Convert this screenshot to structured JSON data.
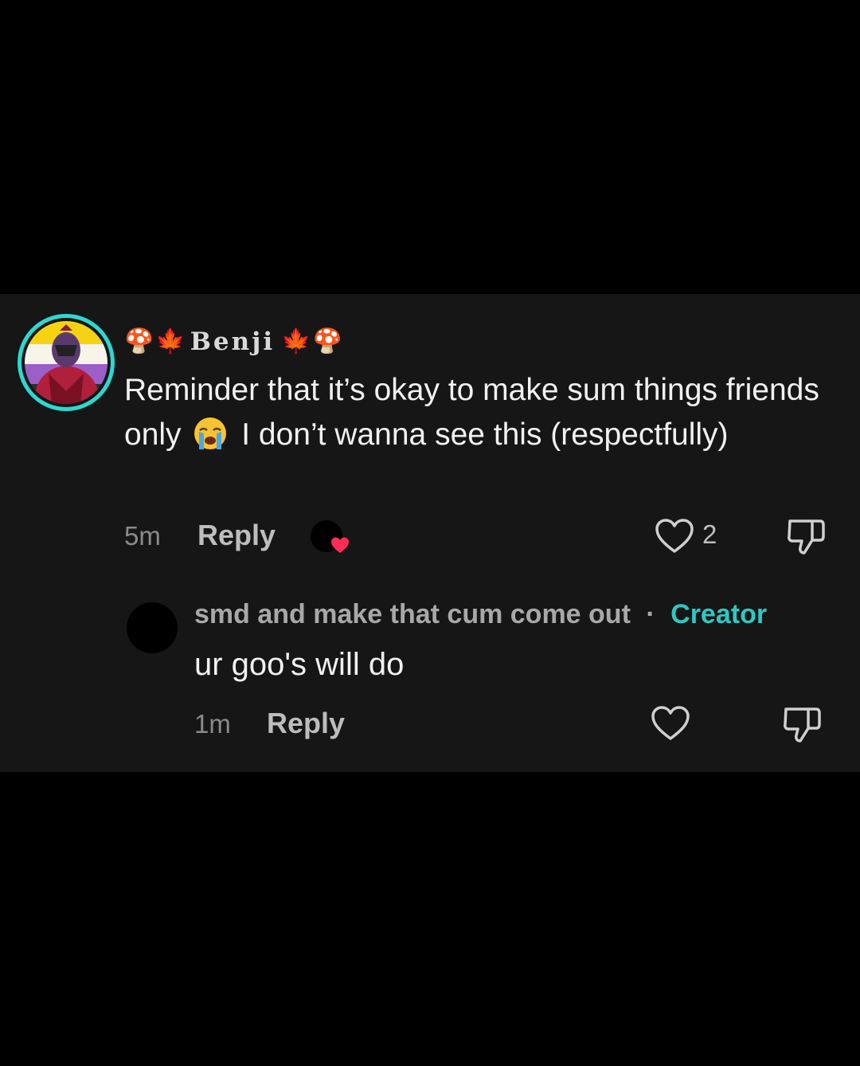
{
  "comment": {
    "username": "Benji",
    "username_emoji_left": [
      "🍄",
      "🍁"
    ],
    "username_emoji_right": [
      "🍁",
      "🍄"
    ],
    "text_part1": "Reminder that it’s okay to make sum things friends only",
    "text_emoji": "😭",
    "text_part2": "I don’t wanna see this (respectfully)",
    "time": "5m",
    "reply_label": "Reply",
    "like_count": "2",
    "avatar_ring_color": "#2ed7d0"
  },
  "reply": {
    "username": "smd and make that cum come out",
    "separator": "·",
    "badge": "Creator",
    "badge_color": "#2fc7c3",
    "text": "ur goo's will do",
    "time": "1m",
    "reply_label": "Reply"
  },
  "icons": {
    "like": "heart-outline-icon",
    "dislike": "thumbs-down-icon",
    "liked_by_creator": "creator-liked-heart-icon"
  }
}
